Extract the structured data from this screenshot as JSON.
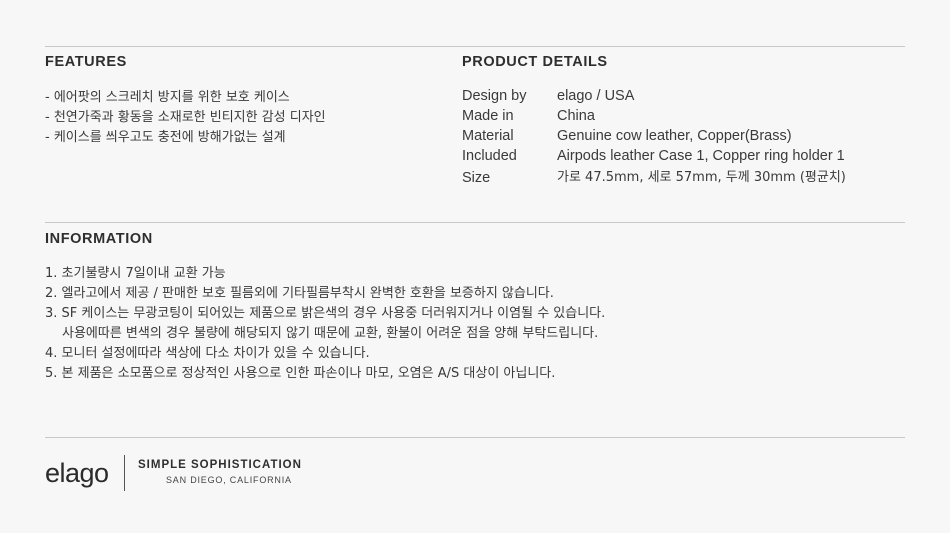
{
  "features": {
    "title": "FEATURES",
    "items": [
      "- 에어팟의 스크레치 방지를 위한 보호 케이스",
      "- 천연가죽과 황동을 소재로한 빈티지한 감성 디자인",
      "- 케이스를 씌우고도 충전에 방해가없는 설계"
    ]
  },
  "product_details": {
    "title": "PRODUCT DETAILS",
    "rows": [
      {
        "label": "Design by",
        "value": "elago / USA"
      },
      {
        "label": "Made in",
        "value": "China"
      },
      {
        "label": "Material",
        "value": "Genuine cow leather, Copper(Brass)"
      },
      {
        "label": "Included",
        "value": "Airpods leather Case 1, Copper ring holder 1"
      },
      {
        "label": "Size",
        "value": "가로  47.5mm, 세로 57mm, 두께 30mm (평균치)"
      }
    ]
  },
  "information": {
    "title": "INFORMATION",
    "items": [
      "1. 초기불량시 7일이내 교환 가능",
      "2. 엘라고에서 제공 / 판매한 보호 필름외에 기타필름부착시 완벽한 호환을 보증하지 않습니다.",
      "3. SF 케이스는 무광코팅이 되어있는 제품으로 밝은색의 경우 사용중 더러워지거나 이염될 수 있습니다.",
      "사용에따른 변색의 경우 불량에 해당되지 않기 때문에 교환, 환불이 어려운 점을 양해 부탁드립니다.",
      "4. 모니터 설정에따라 색상에 다소 차이가 있을 수 있습니다.",
      "5. 본 제품은 소모품으로 정상적인 사용으로 인한 파손이나 마모, 오염은 A/S 대상이 아닙니다."
    ]
  },
  "footer": {
    "logo": "elago",
    "tagline": "SIMPLE SOPHISTICATION",
    "location": "SAN DIEGO, CALIFORNIA"
  }
}
